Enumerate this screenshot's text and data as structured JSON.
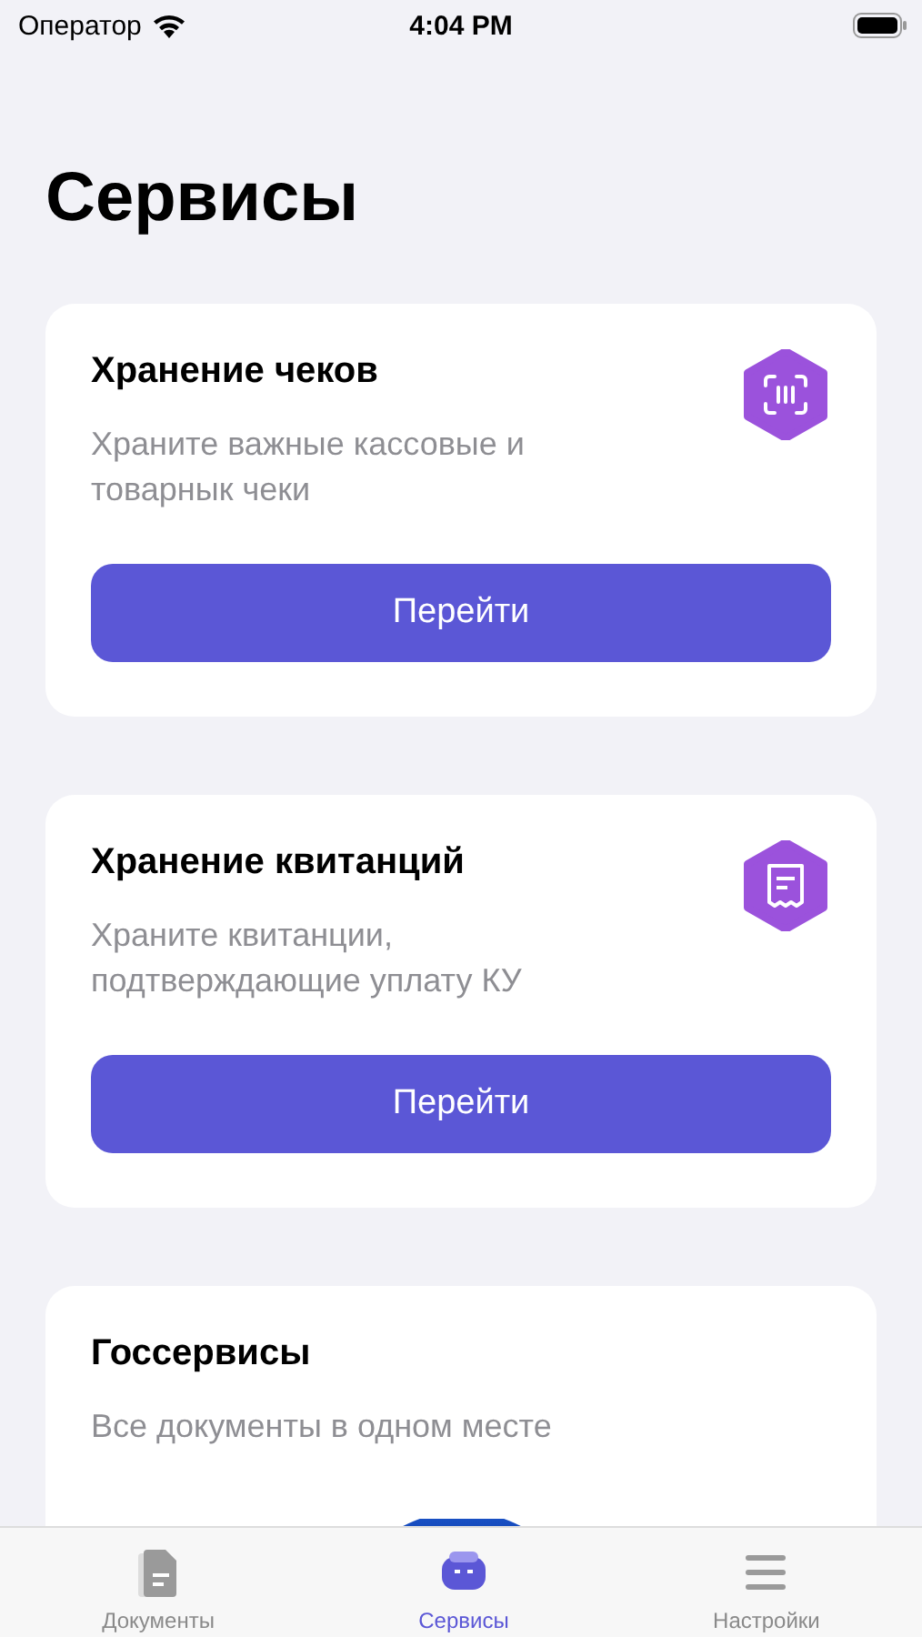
{
  "status_bar": {
    "carrier": "Оператор",
    "time": "4:04 PM"
  },
  "title": "Сервисы",
  "cards": [
    {
      "title": "Хранение чеков",
      "description": "Храните важные кассовые и товарнык чеки",
      "kind": "scan",
      "button": "Перейти"
    },
    {
      "title": "Хранение квитанций",
      "description": "Храните квитанции, подтверждающие уплату КУ",
      "kind": "receipt",
      "button": "Перейти"
    },
    {
      "title": "Госсервисы",
      "description": "Все документы в одном месте",
      "kind": "emblem"
    }
  ],
  "tab_bar": [
    {
      "label": "Документы",
      "kind": "document",
      "selected": false
    },
    {
      "label": "Сервисы",
      "kind": "services",
      "selected": true
    },
    {
      "label": "Настройки",
      "kind": "settings",
      "selected": false
    }
  ]
}
